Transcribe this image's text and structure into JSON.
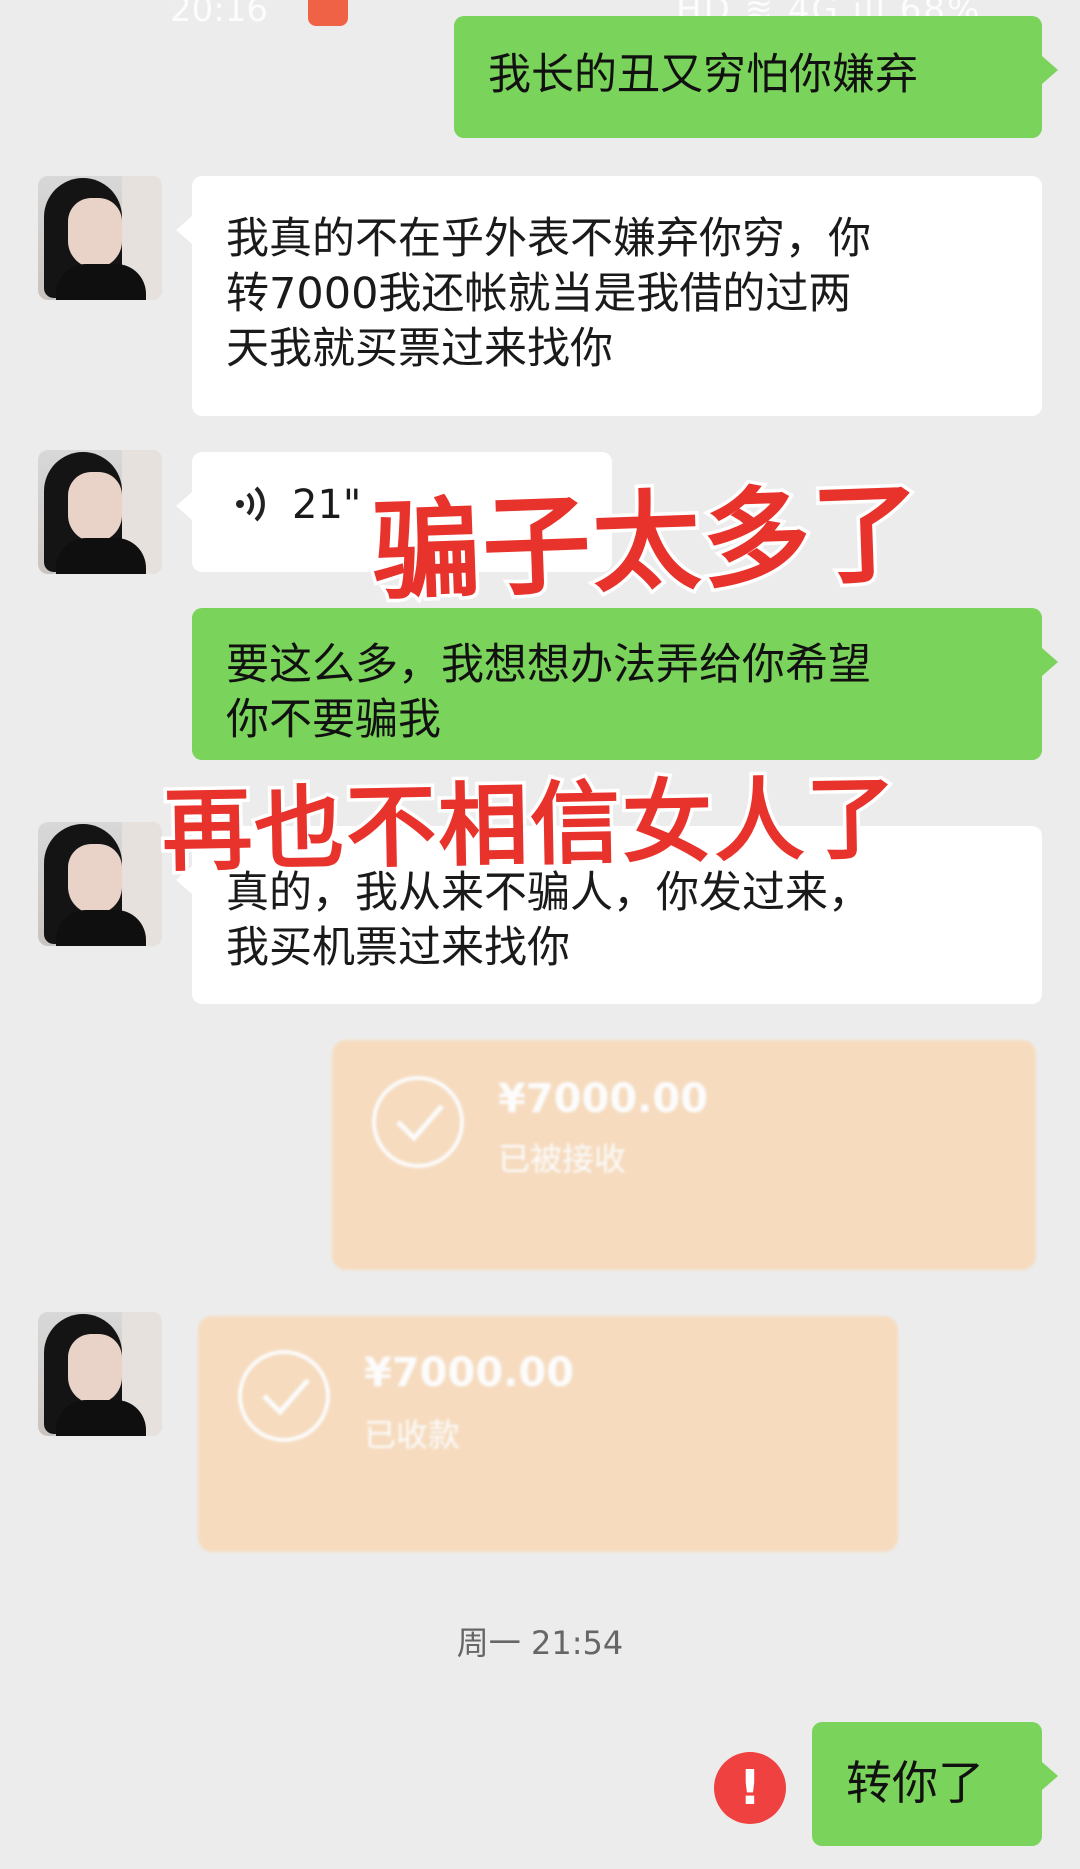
{
  "status_bar": {
    "time": "20:16",
    "right": "HD ≋ 4G ıll 68%"
  },
  "messages": [
    {
      "side": "right",
      "type": "text",
      "text": "我长的丑又穷怕你嫌弃"
    },
    {
      "side": "left",
      "type": "text",
      "lines": [
        "我真的不在乎外表不嫌弃你穷，你",
        "转7000我还帐就当是我借的过两",
        "天我就买票过来找你"
      ]
    },
    {
      "side": "left",
      "type": "voice",
      "duration": "21\""
    },
    {
      "side": "right",
      "type": "text",
      "lines": [
        "要这么多，我想想办法弄给你希望",
        "你不要骗我"
      ]
    },
    {
      "side": "left",
      "type": "text",
      "lines": [
        "真的，我从来不骗人，你发过来，",
        "我买机票过来找你"
      ]
    },
    {
      "side": "right",
      "type": "transfer",
      "amount": "¥7000.00",
      "status": "已被接收"
    },
    {
      "side": "left",
      "type": "transfer",
      "amount": "¥7000.00",
      "status": "已收款"
    },
    {
      "side": "right",
      "type": "text",
      "text": "转你了",
      "failed": true
    }
  ],
  "timestamp": "周一 21:54",
  "overlays": {
    "line1": "骗子太多了",
    "line2": "再也不相信女人了"
  },
  "colors": {
    "background": "#ececec",
    "green_bubble": "#7ad35a",
    "overlay_text": "#e8332c",
    "transfer_card": "#f8d9b8"
  }
}
